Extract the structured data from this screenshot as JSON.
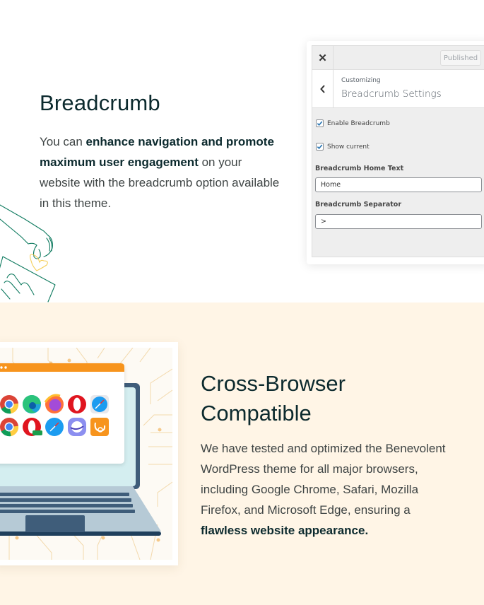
{
  "breadcrumb_section": {
    "title": "Breadcrumb",
    "description_prefix": "You can ",
    "description_bold": "enhance navigation and promote maximum user engagement",
    "description_suffix": " on your website with the breadcrumb option available in this theme.",
    "customizer": {
      "close_label": "✕",
      "published_label": "Published",
      "back_label": "‹",
      "customizing_label": "Customizing",
      "panel_title": "Breadcrumb Settings",
      "checkboxes": [
        {
          "label": "Enable Breadcrumb",
          "checked": true
        },
        {
          "label": "Show current",
          "checked": true
        }
      ],
      "fields": [
        {
          "label": "Breadcrumb Home Text",
          "value": "Home"
        },
        {
          "label": "Breadcrumb Separator",
          "value": ">"
        }
      ]
    }
  },
  "cross_browser_section": {
    "title_line1": "Cross-Browser",
    "title_line2": "Compatible",
    "description_prefix": "We have tested and optimized the Benevolent WordPress theme for all major browsers, including Google Chrome, Safari, Mozilla Firefox, and Microsoft Edge, ensuring a ",
    "description_bold": "flawless website appearance.",
    "browser_icons": [
      "chrome-icon",
      "edge-icon",
      "firefox-icon",
      "opera-icon",
      "safari-icon",
      "chrome-icon",
      "opera-mini-icon",
      "safari-icon",
      "samsung-internet-icon",
      "uc-browser-icon"
    ]
  },
  "colors": {
    "heading": "#0c2a2e",
    "body_text": "#3e4444",
    "section2_bg": "#fff5e6",
    "accent_orange": "#f7941d",
    "line_art_green": "#0e7a5f",
    "heart_yellow": "#f5cf5a",
    "laptop_dark": "#3f5d7a",
    "checkbox_blue": "#2271b1"
  }
}
